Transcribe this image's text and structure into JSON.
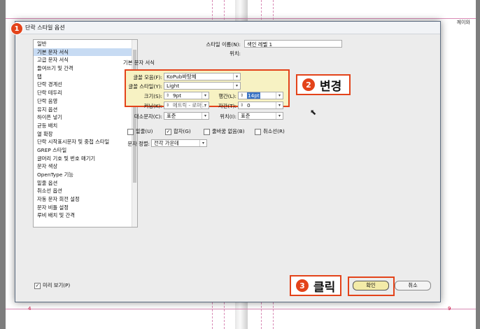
{
  "background": {
    "corner_text": "께이와",
    "page_left_num": "4",
    "page_right_num": "9"
  },
  "dialog": {
    "title": "단락 스타일 옵션",
    "badge1": "1",
    "sidebar": {
      "items": [
        {
          "label": "일반"
        },
        {
          "label": "기본 문자 서식",
          "selected": true
        },
        {
          "label": "고급 문자 서식"
        },
        {
          "label": "들여쓰기 및 간격"
        },
        {
          "label": "탭"
        },
        {
          "label": "단락 경계선"
        },
        {
          "label": "단락 테두리"
        },
        {
          "label": "단락 음영"
        },
        {
          "label": "유지 옵션"
        },
        {
          "label": "하이픈 넣기"
        },
        {
          "label": "균등 배치"
        },
        {
          "label": "열 확장"
        },
        {
          "label": "단락 시작표시문자 및 중첩 스타일"
        },
        {
          "label": "GREP 스타일"
        },
        {
          "label": "글머리 기호 및 번호 매기기"
        },
        {
          "label": "문자 색상"
        },
        {
          "label": "OpenType 기능"
        },
        {
          "label": "밑줄 옵션"
        },
        {
          "label": "취소선 옵션"
        },
        {
          "label": "자동 문자 회전 설정"
        },
        {
          "label": "문자 비틀 설정"
        },
        {
          "label": "루비 배치 및 간격"
        }
      ]
    },
    "style_name_label": "스타일 이름(N):",
    "style_name_value": "색인 레벨 1",
    "location_label": "위치:",
    "section_title": "기본 문자 서식",
    "font_family_label": "글꼴 모음(F):",
    "font_family_value": "KoPub바탕체",
    "font_style_label": "글꼴 스타일(Y):",
    "font_style_value": "Light",
    "size_label": "크기(S):",
    "size_value": "9pt",
    "leading_label": "행간(L):",
    "leading_value": "14pt",
    "kerning_label": "커닝(K):",
    "kerning_value": "메트릭 - 로마...",
    "tracking_label": "자간(T):",
    "tracking_value": "0",
    "case_label": "대소문자(C):",
    "case_value": "표준",
    "position_label": "위치(I):",
    "position_value": "표준",
    "checks": {
      "underline": "밑줄(U)",
      "ligatures": "합자(G)",
      "nobreak": "줄바꿈 없음(B)",
      "strike": "취소선(R)"
    },
    "align_label": "문자 정렬:",
    "align_value": "전각 가운데",
    "preview_label": "미리 보기(P)",
    "ok_label": "확인",
    "cancel_label": "취소"
  },
  "callouts": {
    "change_num": "2",
    "change_text": "변경",
    "click_num": "3",
    "click_text": "클릭"
  },
  "colors": {
    "accent": "#e3431a",
    "highlight": "#f7f2c3",
    "selection": "#c7dbf3"
  }
}
